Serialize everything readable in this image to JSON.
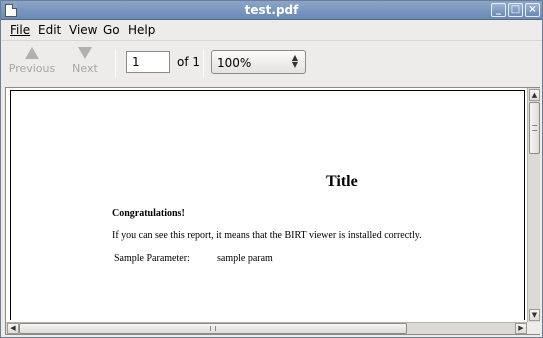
{
  "window": {
    "title": "test.pdf",
    "minimize_glyph": "_",
    "maximize_glyph": "□",
    "close_glyph": "×"
  },
  "menu": {
    "file": "File",
    "edit": "Edit",
    "view": "View",
    "go": "Go",
    "help": "Help"
  },
  "toolbar": {
    "previous_label": "Previous",
    "next_label": "Next",
    "page_value": "1",
    "of_label": "of 1",
    "zoom_value": "100%",
    "previous_enabled": false,
    "next_enabled": false
  },
  "document": {
    "title": "Title",
    "congrats": "Congratulations!",
    "message": "If you can see this report, it means that the BIRT viewer is installed correctly.",
    "param_label": "Sample Parameter:",
    "param_value": "sample param"
  },
  "colors": {
    "titlebar": "#7897c0",
    "window_bg": "#edecea",
    "page_bg": "#ffffff"
  },
  "icons": {
    "previous": "up-triangle-icon",
    "next": "down-triangle-icon",
    "zoom_dropdown": "up-down-chevron-icon"
  }
}
